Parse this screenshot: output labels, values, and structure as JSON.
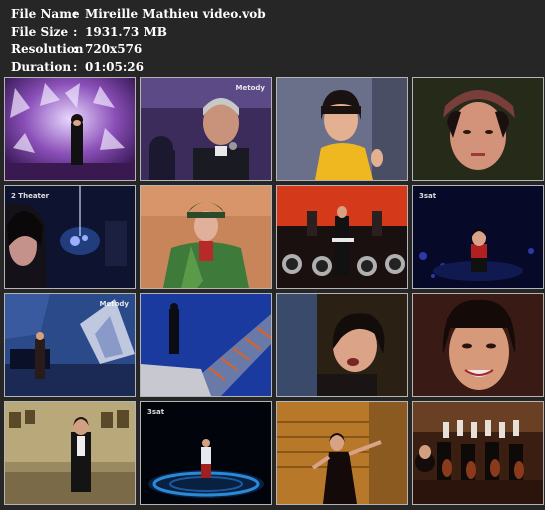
{
  "file_info": [
    {
      "key": "File Name",
      "sep": ":",
      "value": "Mireille Mathieu video.vob"
    },
    {
      "key": "File Size",
      "sep": ":",
      "value": "1931.73 MB"
    },
    {
      "key": "Resolution",
      "sep": ":",
      "value": "720x576"
    },
    {
      "key": "Duration",
      "sep": ":",
      "value": "01:05:26"
    }
  ],
  "thumbnails": [
    {
      "name": "thumbnail-1-crystal-stage",
      "logo": ""
    },
    {
      "name": "thumbnail-2-male-singer",
      "logo": "Metody"
    },
    {
      "name": "thumbnail-3-yellow-dress",
      "logo": ""
    },
    {
      "name": "thumbnail-4-closeup-hat",
      "logo": ""
    },
    {
      "name": "thumbnail-5-dark-stage",
      "logo": "2 Theater"
    },
    {
      "name": "thumbnail-6-green-coat",
      "logo": ""
    },
    {
      "name": "thumbnail-7-motorcycles",
      "logo": ""
    },
    {
      "name": "thumbnail-8-dark-blue-stage",
      "logo": "3sat"
    },
    {
      "name": "thumbnail-9-blue-set",
      "logo": "Metody"
    },
    {
      "name": "thumbnail-10-staircase",
      "logo": ""
    },
    {
      "name": "thumbnail-11-singing-profile",
      "logo": ""
    },
    {
      "name": "thumbnail-12-smiling-closeup",
      "logo": ""
    },
    {
      "name": "thumbnail-13-museum-hall",
      "logo": ""
    },
    {
      "name": "thumbnail-14-round-stage",
      "logo": "3sat"
    },
    {
      "name": "thumbnail-15-wooden-stage",
      "logo": ""
    },
    {
      "name": "thumbnail-16-orchestra",
      "logo": ""
    }
  ]
}
